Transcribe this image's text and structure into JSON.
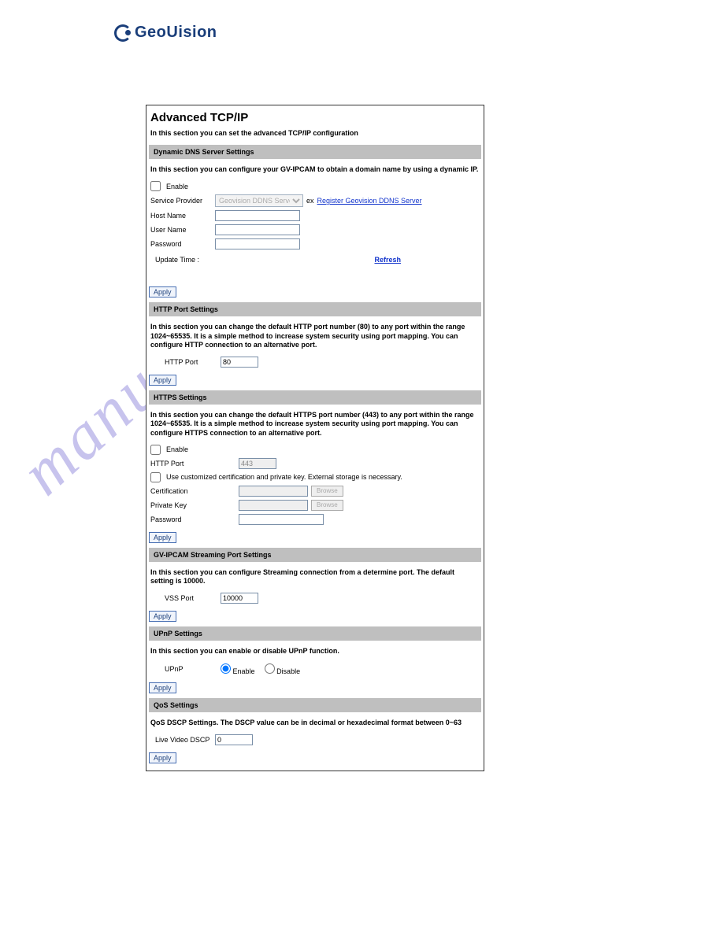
{
  "logo": {
    "text": "GeoUision"
  },
  "watermark": "manualshive.com",
  "panel": {
    "title": "Advanced TCP/IP",
    "subtitle": "In this section you can set the advanced TCP/IP configuration"
  },
  "ddns": {
    "header": "Dynamic DNS Server Settings",
    "desc": "In this section you can configure your GV-IPCAM to obtain a domain name by using a dynamic IP.",
    "enable": "Enable",
    "service_provider": "Service Provider",
    "service_provider_value": "Geovision DDNS Server",
    "ex": "ex",
    "register_link": "Register Geovision DDNS Server",
    "host_name": "Host Name",
    "user_name": "User Name",
    "password": "Password",
    "update_time": "Update Time :",
    "refresh": "Refresh",
    "apply": "Apply"
  },
  "http": {
    "header": "HTTP Port Settings",
    "desc": "In this section you can change the default HTTP port number (80) to any port within the range 1024~65535. It is a simple method to increase system security using port mapping. You can configure HTTP connection to an alternative port.",
    "port_label": "HTTP Port",
    "port_value": "80",
    "apply": "Apply"
  },
  "https": {
    "header": "HTTPS Settings",
    "desc": "In this section you can change the default HTTPS port number (443) to any port within the range 1024~65535. It is a simple method to increase system security using port mapping. You can configure HTTPS connection to an alternative port.",
    "enable": "Enable",
    "port_label": "HTTP Port",
    "port_value": "443",
    "custom_cert": "Use customized certification and private key. External storage is necessary.",
    "certification": "Certification",
    "private_key": "Private Key",
    "password": "Password",
    "browse": "Browse",
    "apply": "Apply"
  },
  "streaming": {
    "header": "GV-IPCAM Streaming Port Settings",
    "desc": "In this section you can configure Streaming connection from a determine port. The default setting is 10000.",
    "port_label": "VSS Port",
    "port_value": "10000",
    "apply": "Apply"
  },
  "upnp": {
    "header": "UPnP Settings",
    "desc": "In this section you can enable or disable UPnP function.",
    "label": "UPnP",
    "enable": "Enable",
    "disable": "Disable",
    "apply": "Apply"
  },
  "qos": {
    "header": "QoS Settings",
    "desc": "QoS DSCP Settings. The DSCP value can be in decimal or hexadecimal format between 0~63",
    "dscp_label": "Live Video DSCP",
    "dscp_value": "0",
    "apply": "Apply"
  }
}
